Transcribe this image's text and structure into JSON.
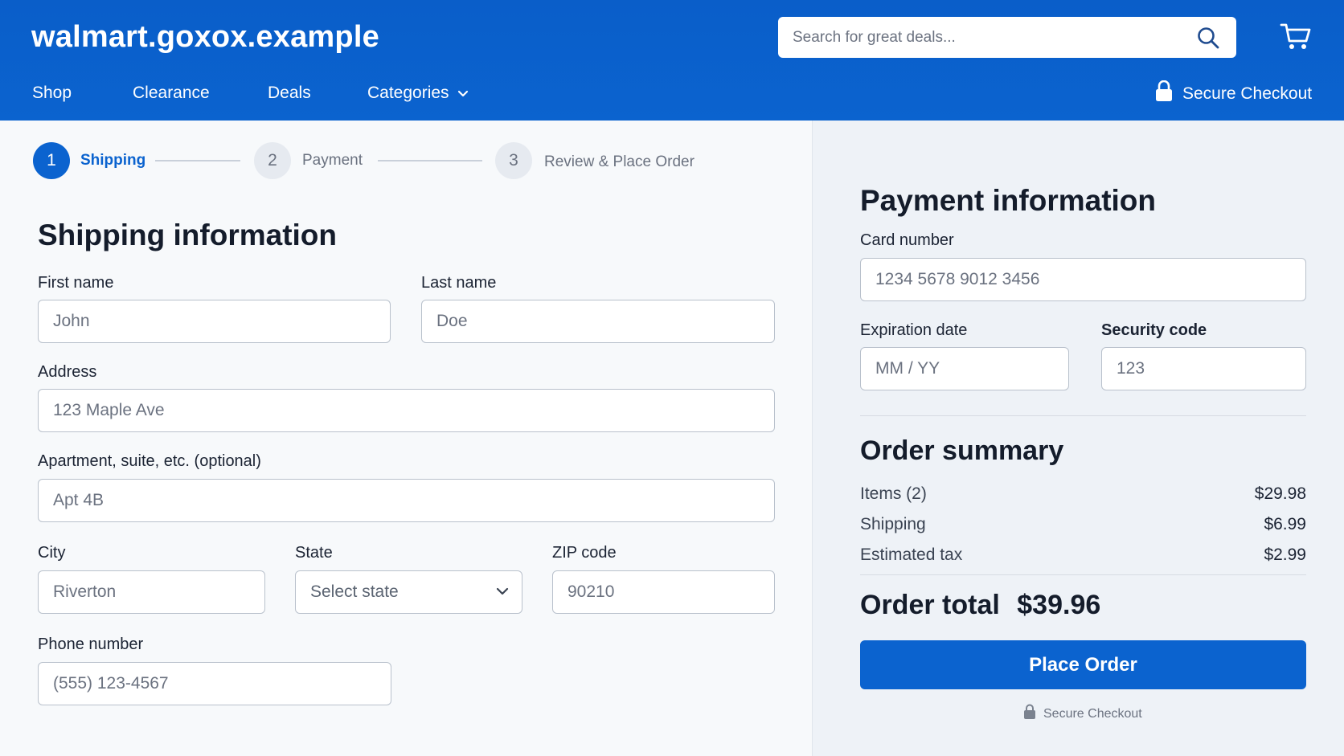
{
  "header": {
    "brand": "walmart.goxox.example",
    "search_placeholder": "Search for great deals...",
    "nav": [
      "Shop",
      "Clearance",
      "Deals",
      "Categories"
    ],
    "secure_checkout": "Secure Checkout"
  },
  "stepper": {
    "steps": [
      {
        "number": "1",
        "label": "Shipping",
        "state": "active"
      },
      {
        "number": "2",
        "label": "Payment",
        "state": "inactive"
      },
      {
        "number": "3",
        "label": "Review & Place Order",
        "state": "inactive"
      }
    ]
  },
  "shipping": {
    "title": "Shipping information",
    "first_name_label": "First name",
    "first_name_placeholder": "John",
    "last_name_label": "Last name",
    "last_name_placeholder": "Doe",
    "address_label": "Address",
    "address_placeholder": "123 Maple Ave",
    "apt_label": "Apartment, suite, etc. (optional)",
    "apt_placeholder": "Apt 4B",
    "city_label": "City",
    "city_placeholder": "Riverton",
    "state_label": "State",
    "state_value": "Select state",
    "zip_label": "ZIP code",
    "zip_placeholder": "90210",
    "phone_label": "Phone number",
    "phone_placeholder": "(555) 123-4567"
  },
  "payment": {
    "title": "Payment information",
    "card_label": "Card number",
    "card_placeholder": "1234 5678 9012 3456",
    "exp_label": "Expiration date",
    "exp_placeholder": "MM / YY",
    "cvc_label": "Security code",
    "cvc_placeholder": "123"
  },
  "summary": {
    "title": "Order summary",
    "rows": [
      {
        "label": "Items (2)",
        "value": "$29.98"
      },
      {
        "label": "Shipping",
        "value": "$6.99"
      },
      {
        "label": "Estimated tax",
        "value": "$2.99"
      }
    ],
    "total_label": "Order total",
    "total_value": "$39.96",
    "place_order": "Place Order",
    "secure_note": "Secure Checkout"
  },
  "colors": {
    "brand_blue": "#0b63cf",
    "page_bg": "#f7f9fb",
    "summary_bg": "#eef2f7"
  },
  "icons": [
    "search-icon",
    "cart-icon",
    "chevron-down-icon",
    "lock-icon"
  ]
}
